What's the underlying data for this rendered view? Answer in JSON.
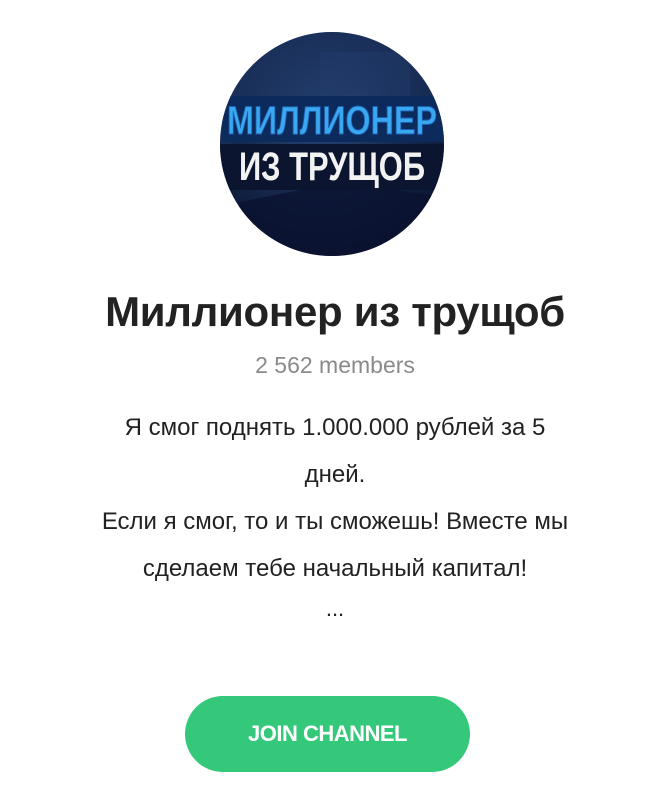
{
  "channel": {
    "avatar": {
      "line1": "МИЛЛИОНЕР",
      "line2": "ИЗ ТРУЩОБ",
      "accent_color": "#3aa8f0",
      "background_color": "#0f1f42"
    },
    "title": "Миллионер из трущоб",
    "members": "2 562 members",
    "description": {
      "lines": [
        "Я смог поднять 1.000.000 рублей за 5",
        "дней.",
        "Если я смог, то и ты сможешь! Вместе мы",
        "сделаем тебе начальный капитал!"
      ],
      "ellipsis": "..."
    },
    "join_label": "JOIN CHANNEL",
    "join_color": "#33c87a"
  }
}
